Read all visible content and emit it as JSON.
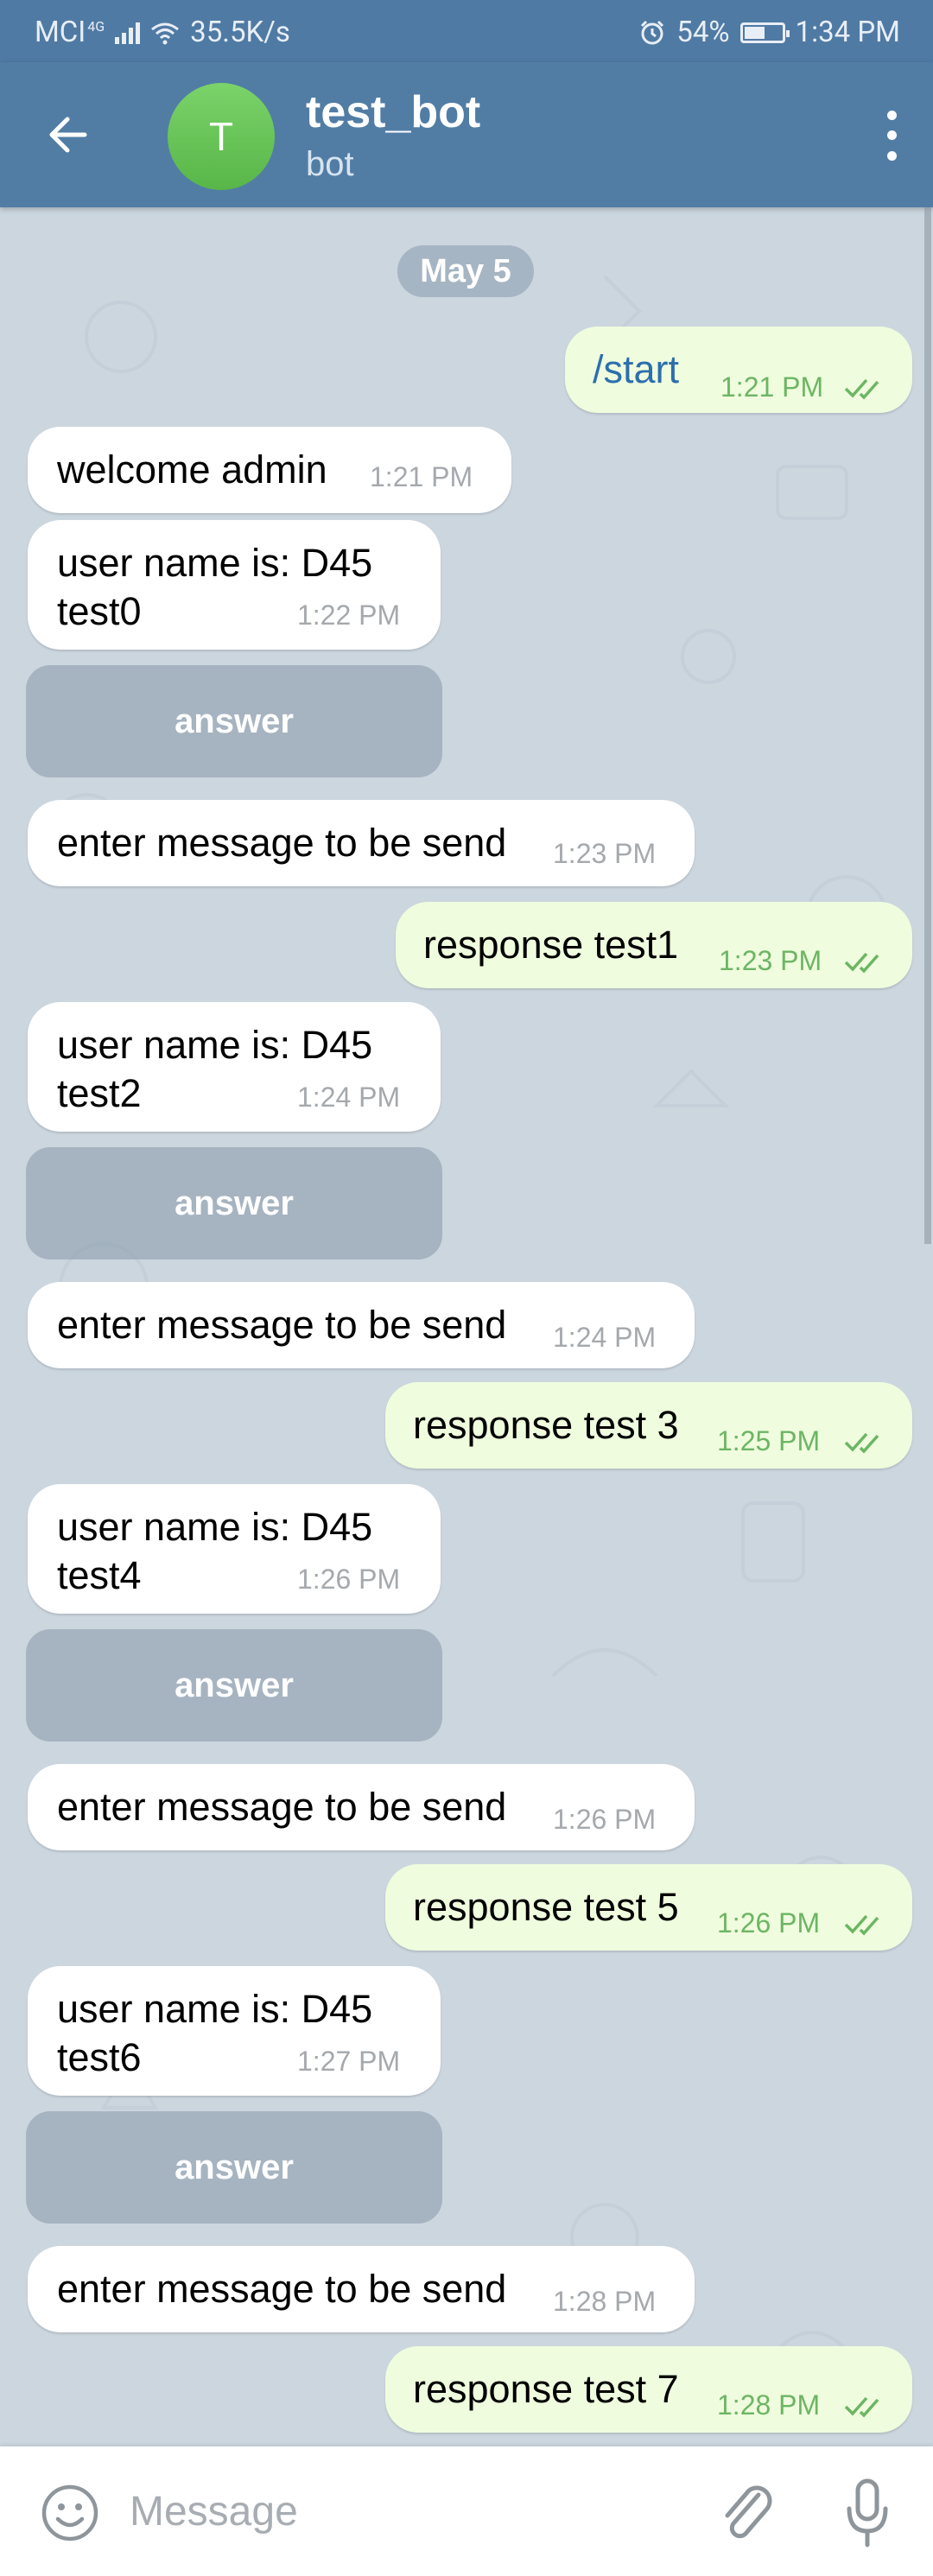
{
  "status_bar": {
    "carrier": "MCI",
    "network": "4G",
    "speed": "35.5K/s",
    "battery": "54%",
    "battery_level": 0.54,
    "time": "1:34 PM"
  },
  "header": {
    "avatar_letter": "T",
    "title": "test_bot",
    "subtitle": "bot",
    "accent": "#517da5",
    "avatar_color": "#6cc55b"
  },
  "chat": {
    "date": "May 5",
    "messages": [
      {
        "dir": "out",
        "text": "/start",
        "time": "1:21 PM"
      },
      {
        "dir": "in",
        "text": "welcome admin",
        "time": "1:21 PM"
      },
      {
        "dir": "in",
        "text": "user name is: D45\ntest0",
        "time": "1:22 PM",
        "button": "answer"
      },
      {
        "dir": "in",
        "text": "enter message to be send",
        "time": "1:23 PM"
      },
      {
        "dir": "out",
        "text": "response test1",
        "time": "1:23 PM"
      },
      {
        "dir": "in",
        "text": "user name is: D45\ntest2",
        "time": "1:24 PM",
        "button": "answer"
      },
      {
        "dir": "in",
        "text": "enter message to be send",
        "time": "1:24 PM"
      },
      {
        "dir": "out",
        "text": "response test 3",
        "time": "1:25 PM"
      },
      {
        "dir": "in",
        "text": "user name is: D45\ntest4",
        "time": "1:26 PM",
        "button": "answer"
      },
      {
        "dir": "in",
        "text": "enter message to be send",
        "time": "1:26 PM"
      },
      {
        "dir": "out",
        "text": "response test 5",
        "time": "1:26 PM"
      },
      {
        "dir": "in",
        "text": "user name is: D45\ntest6",
        "time": "1:27 PM",
        "button": "answer"
      },
      {
        "dir": "in",
        "text": "enter message to be send",
        "time": "1:28 PM"
      },
      {
        "dir": "out",
        "text": "response test 7",
        "time": "1:28 PM"
      }
    ]
  },
  "input": {
    "placeholder": "Message"
  }
}
